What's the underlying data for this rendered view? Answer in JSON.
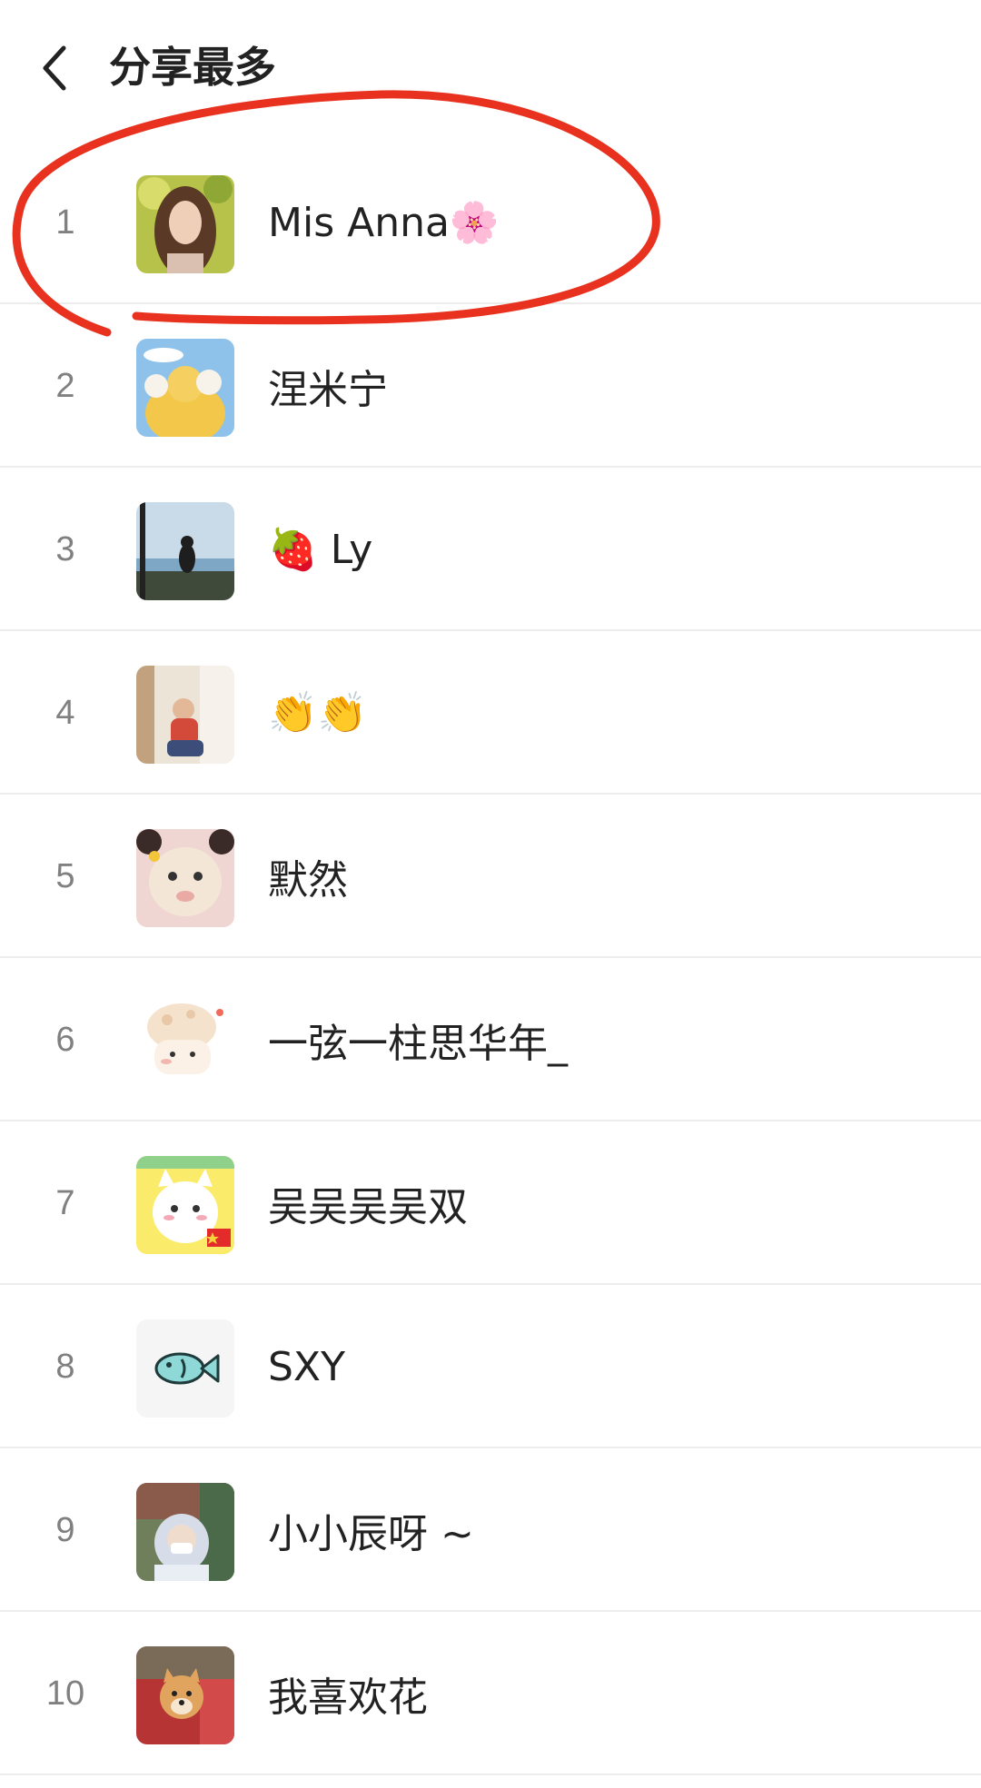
{
  "header": {
    "title": "分享最多"
  },
  "icons": {
    "back": "chevron-left-icon"
  },
  "colors": {
    "annotation": "#e8321f",
    "divider": "#ececec",
    "rank_text": "#808080"
  },
  "ranking": [
    {
      "rank": "1",
      "name": "Mis Anna🌸"
    },
    {
      "rank": "2",
      "name": "涅米宁"
    },
    {
      "rank": "3",
      "name": "🍓 Ly"
    },
    {
      "rank": "4",
      "name": "👏👏"
    },
    {
      "rank": "5",
      "name": "默然"
    },
    {
      "rank": "6",
      "name": "一弦一柱思华年_"
    },
    {
      "rank": "7",
      "name": "吴吴吴吴双"
    },
    {
      "rank": "8",
      "name": "SXY"
    },
    {
      "rank": "9",
      "name": "小小辰呀 ~"
    },
    {
      "rank": "10",
      "name": "我喜欢花"
    }
  ]
}
